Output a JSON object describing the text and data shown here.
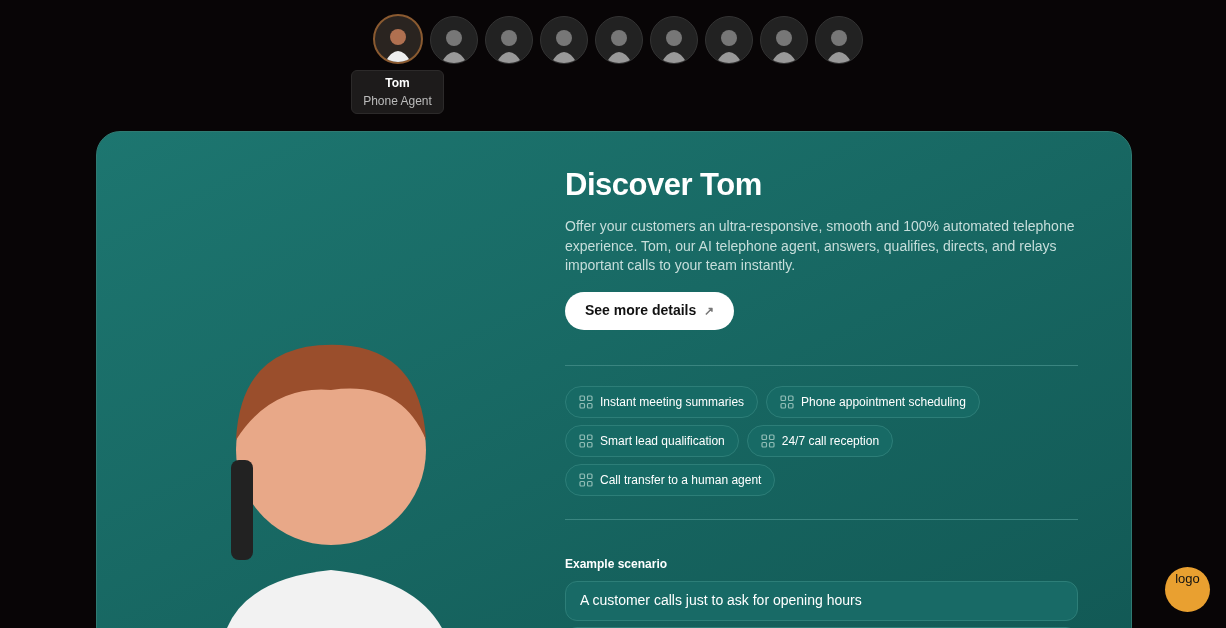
{
  "agents": [
    {
      "selected": true
    },
    {
      "selected": false
    },
    {
      "selected": false
    },
    {
      "selected": false
    },
    {
      "selected": false
    },
    {
      "selected": false
    },
    {
      "selected": false
    },
    {
      "selected": false
    },
    {
      "selected": false
    }
  ],
  "tooltip": {
    "name": "Tom",
    "role": "Phone Agent"
  },
  "card": {
    "title": "Discover Tom",
    "description": "Offer your customers an ultra-responsive, smooth and 100% automated telephone experience. Tom, our AI telephone agent, answers, qualifies, directs, and relays important calls to your team instantly.",
    "button": "See more details",
    "button_icon": "↗",
    "features": [
      "Instant meeting summaries",
      "Phone appointment scheduling",
      "Smart lead qualification",
      "24/7 call reception",
      "Call transfer to a human agent"
    ],
    "scenario_label": "Example scenario",
    "scenarios": [
      "A customer calls just to ask for opening hours"
    ]
  },
  "floating_logo": {
    "alt": "logo"
  }
}
